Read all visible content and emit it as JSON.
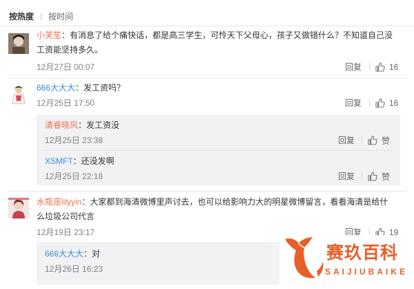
{
  "sort": {
    "hot_label": "按热度",
    "time_label": "按时间"
  },
  "comments": [
    {
      "username": "小芙笙",
      "text_line1": "：有消息了给个痛快话，都是高三学生，可怜天下父母心，孩子又做错什么？不知道自己没",
      "text_line2": "工资能坚持多久。",
      "time": "12月27日 00:07",
      "reply_label": "回复",
      "likes": "16"
    },
    {
      "username": "666大大大",
      "text_line1": "：发工资吗？",
      "time": "12月25日 17:50",
      "reply_label": "回复",
      "likes": "16",
      "replies": [
        {
          "username": "清睿晓风",
          "text": "：发工资没",
          "time": "12月25日 23:38",
          "reply_label": "回复",
          "like_label": "赞"
        },
        {
          "username": "XSMFT",
          "text": "：还没发啊",
          "time": "12月25日 22:18",
          "reply_label": "回复",
          "like_label": "赞"
        }
      ]
    },
    {
      "username": "水瓶座lilyyin",
      "text_line1": "：大家都到海清微博里声讨去，也可以给影响力大的明星微博留言，看看海清是给什",
      "text_line2": "么垃圾公司代言",
      "time": "12月19日 23:17",
      "reply_label": "回复",
      "likes": "19",
      "replies": [
        {
          "username": "666大大大",
          "text": "：对",
          "time": "12月26日 16:23"
        }
      ]
    }
  ],
  "watermark": {
    "name_cn": "赛玖百科",
    "name_en": "SAIJIUBAIKE"
  },
  "colors": {
    "username": "#eb7350",
    "username_blue": "#3b8bd6",
    "timestamp": "#808080",
    "brand": "#e85f2a"
  }
}
